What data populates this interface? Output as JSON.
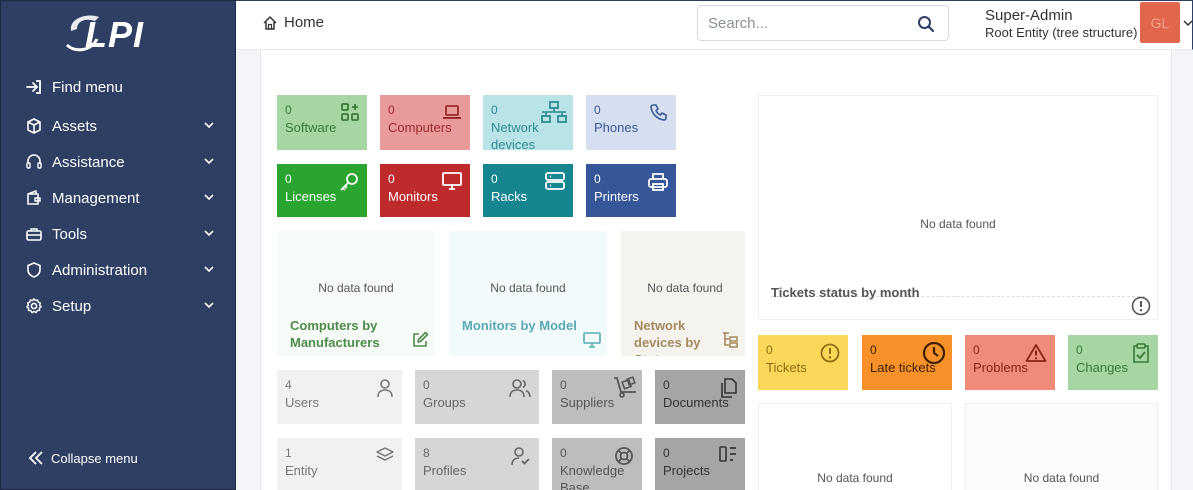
{
  "sidebar": {
    "logo_text": "GLPI",
    "items": [
      {
        "label": "Find menu",
        "icon": "arrow-right-to-bracket-icon"
      },
      {
        "label": "Assets",
        "icon": "cube-icon"
      },
      {
        "label": "Assistance",
        "icon": "headset-icon"
      },
      {
        "label": "Management",
        "icon": "wallet-icon"
      },
      {
        "label": "Tools",
        "icon": "briefcase-icon"
      },
      {
        "label": "Administration",
        "icon": "shield-icon"
      },
      {
        "label": "Setup",
        "icon": "gear-icon"
      }
    ],
    "collapse_label": "Collapse menu"
  },
  "header": {
    "breadcrumb": "Home",
    "search_placeholder": "Search...",
    "user_name": "Super-Admin",
    "user_entity": "Root Entity (tree structure)",
    "avatar_initials": "GL"
  },
  "asset_tiles": [
    {
      "count": "0",
      "label": "Software",
      "icon": "apps-icon",
      "bg": "#a6d6a1",
      "fg": "#3a7a36"
    },
    {
      "count": "0",
      "label": "Computers",
      "icon": "laptop-icon",
      "bg": "#e99a9a",
      "fg": "#9b2b2b"
    },
    {
      "count": "0",
      "label": "Network devices",
      "icon": "network-icon",
      "bg": "#b8e3e7",
      "fg": "#2d8a93"
    },
    {
      "count": "0",
      "label": "Phones",
      "icon": "phone-icon",
      "bg": "#d6dff0",
      "fg": "#3a5a99"
    },
    {
      "count": "0",
      "label": "Licenses",
      "icon": "key-icon",
      "bg": "#2aa52f",
      "fg": "#ffffff"
    },
    {
      "count": "0",
      "label": "Monitors",
      "icon": "monitor-icon",
      "bg": "#bf2a2d",
      "fg": "#ffffff"
    },
    {
      "count": "0",
      "label": "Racks",
      "icon": "server-icon",
      "bg": "#15858f",
      "fg": "#ffffff"
    },
    {
      "count": "0",
      "label": "Printers",
      "icon": "printer-icon",
      "bg": "#35579a",
      "fg": "#ffffff"
    }
  ],
  "asset_widgets": [
    {
      "nodata": "No data found",
      "title": "Computers by Manufacturers",
      "icon": "edit-icon",
      "bg": "#f7fbf7",
      "fg": "#4e8a4a"
    },
    {
      "nodata": "No data found",
      "title": "Monitors by Model",
      "icon": "monitor-icon",
      "bg": "#f3fafb",
      "fg": "#58a9b3"
    },
    {
      "nodata": "No data found",
      "title": "Network devices by Status",
      "icon": "tree-icon",
      "bg": "#f5f3ee",
      "fg": "#a58a5f"
    }
  ],
  "admin_tiles": [
    {
      "count": "4",
      "label": "Users",
      "icon": "user-icon",
      "bg": "#f1f1f1",
      "fg": "#777777"
    },
    {
      "count": "0",
      "label": "Groups",
      "icon": "users-icon",
      "bg": "#d6d6d6",
      "fg": "#666666"
    },
    {
      "count": "0",
      "label": "Suppliers",
      "icon": "dolly-icon",
      "bg": "#bdbdbd",
      "fg": "#555555"
    },
    {
      "count": "0",
      "label": "Documents",
      "icon": "files-icon",
      "bg": "#a5a5a5",
      "fg": "#333333"
    },
    {
      "count": "1",
      "label": "Entity",
      "icon": "stack-icon",
      "bg": "#f1f1f1",
      "fg": "#777777"
    },
    {
      "count": "8",
      "label": "Profiles",
      "icon": "user-check-icon",
      "bg": "#d6d6d6",
      "fg": "#666666"
    },
    {
      "count": "0",
      "label": "Knowledge Base",
      "icon": "lifebuoy-icon",
      "bg": "#bdbdbd",
      "fg": "#555555"
    },
    {
      "count": "0",
      "label": "Projects",
      "icon": "columns-icon",
      "bg": "#a5a5a5",
      "fg": "#333333"
    }
  ],
  "tickets_widget": {
    "nodata": "No data found",
    "title": "Tickets status by month",
    "icon": "info-circle-icon"
  },
  "assistance_tiles": [
    {
      "count": "0",
      "label": "Tickets",
      "icon": "exclamation-circle-icon",
      "bg": "#fbd75a",
      "fg": "#8a6d12"
    },
    {
      "count": "0",
      "label": "Late tickets",
      "icon": "clock-icon",
      "bg": "#f9912b",
      "fg": "#3d2000"
    },
    {
      "count": "0",
      "label": "Problems",
      "icon": "warning-triangle-icon",
      "bg": "#f08b7a",
      "fg": "#8a2317"
    },
    {
      "count": "0",
      "label": "Changes",
      "icon": "clipboard-check-icon",
      "bg": "#a6d6a1",
      "fg": "#3a7a36"
    }
  ],
  "bottom_widgets": [
    {
      "nodata": "No data found"
    },
    {
      "nodata": "No data found"
    }
  ]
}
